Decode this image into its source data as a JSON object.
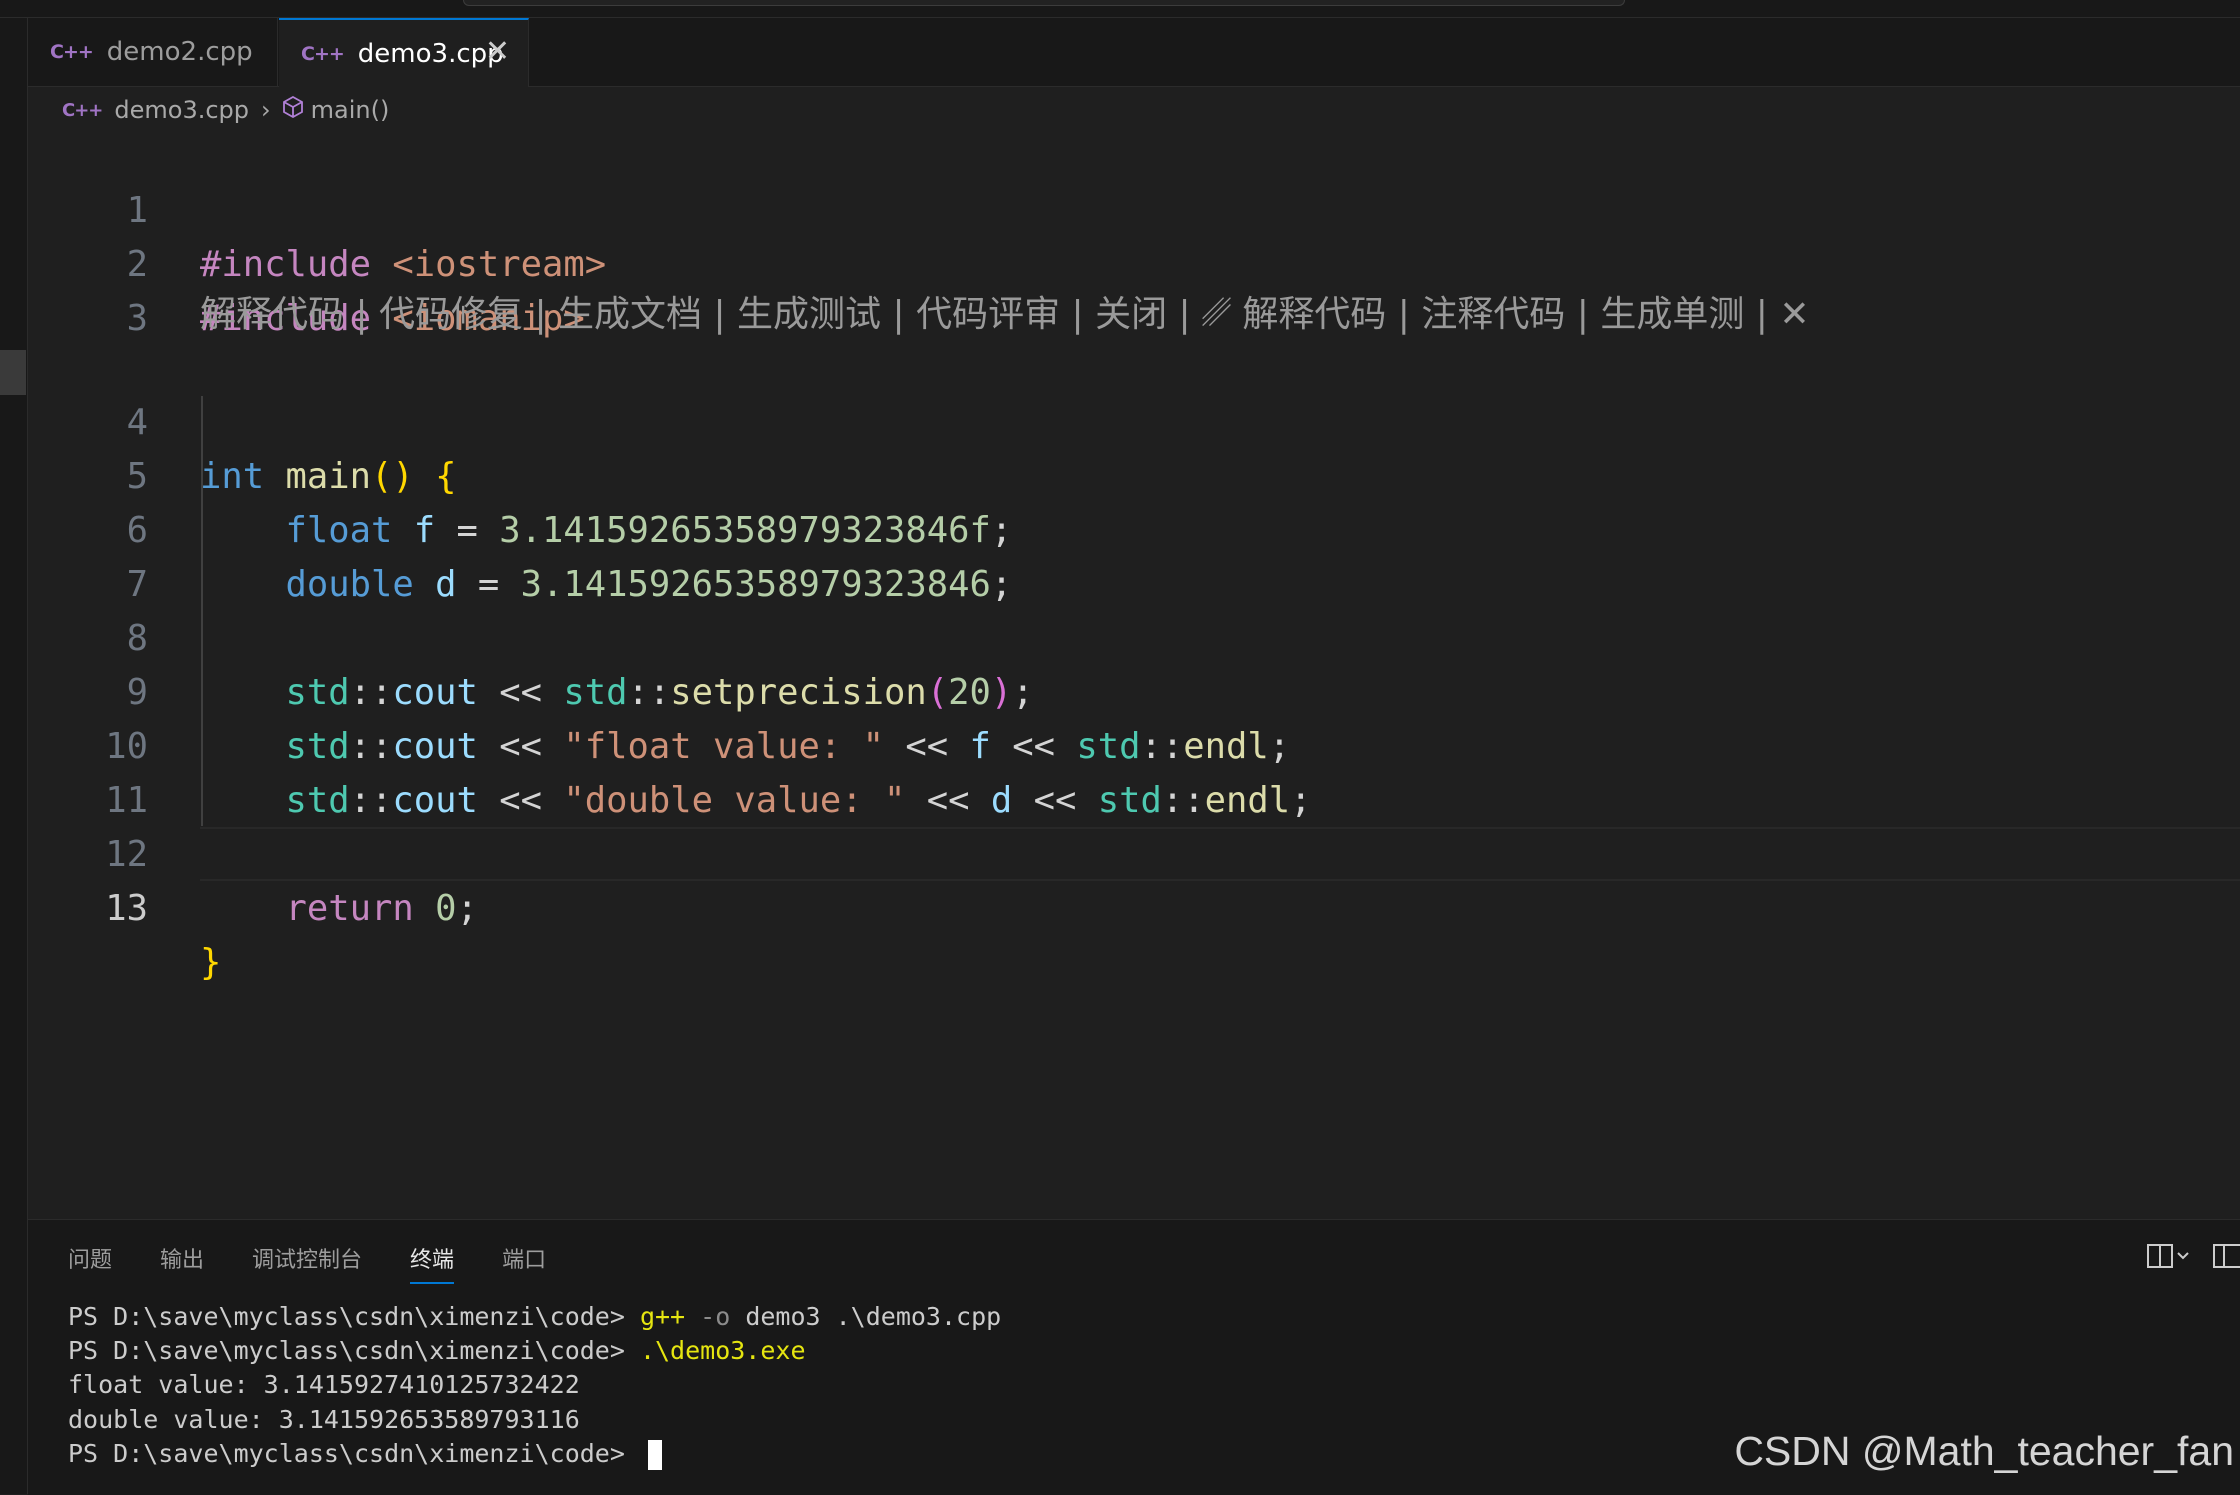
{
  "tabs": [
    {
      "icon": "C++",
      "label": "demo2.cpp",
      "active": false
    },
    {
      "icon": "C++",
      "label": "demo3.cpp",
      "active": true,
      "close": "✕"
    }
  ],
  "breadcrumb": {
    "file": "demo3.cpp",
    "separator": "›",
    "symbol": "main()"
  },
  "codelens": "解释代码 | 代码修复 | 生成文档 | 生成测试 | 代码评审 | 关闭 | ␥ 解释代码 | 注释代码 | 生成单测 | ✕",
  "line_numbers": [
    "1",
    "2",
    "3",
    "4",
    "5",
    "6",
    "7",
    "8",
    "9",
    "10",
    "11",
    "12",
    "13"
  ],
  "code": {
    "l1": {
      "kw": "#include",
      "arg": " <iostream>"
    },
    "l2": {
      "kw": "#include",
      "arg": " <iomanip>"
    },
    "l4": {
      "type": "int",
      "fn": "main",
      "paren": "()",
      "brace": "{"
    },
    "l5": {
      "type": "float",
      "var": "f",
      "op": " = ",
      "num": "3.14159265358979323846f",
      "end": ";"
    },
    "l6": {
      "type": "double",
      "var": "d",
      "op": " = ",
      "num": "3.14159265358979323846",
      "end": ";"
    },
    "l8": {
      "ns1": "std",
      "sep": "::",
      "var1": "cout",
      "op": " << ",
      "ns2": "std",
      "fn": "setprecision",
      "p1": "(",
      "num": "20",
      "p2": ")",
      "end": ";"
    },
    "l9": {
      "ns1": "std",
      "sep": "::",
      "var1": "cout",
      "op": " << ",
      "str": "\"float value: \"",
      "op2": " << ",
      "v": "f",
      "op3": " << ",
      "ns2": "std",
      "fn": "endl",
      "end": ";"
    },
    "l10": {
      "ns1": "std",
      "sep": "::",
      "var1": "cout",
      "op": " << ",
      "str": "\"double value: \"",
      "op2": " << ",
      "v": "d",
      "op3": " << ",
      "ns2": "std",
      "fn": "endl",
      "end": ";"
    },
    "l12": {
      "kw": "return",
      "num": "0",
      "end": ";"
    },
    "l13": {
      "brace": "}"
    }
  },
  "panel": {
    "tabs": [
      "问题",
      "输出",
      "调试控制台",
      "终端",
      "端口"
    ],
    "active_tab": "终端"
  },
  "terminal": {
    "l1_prompt": "PS D:\\save\\myclass\\csdn\\ximenzi\\code> ",
    "l1_cmd": "g++",
    "l1_flag": " -o",
    "l1_args": " demo3 .\\demo3.cpp",
    "l2_prompt": "PS D:\\save\\myclass\\csdn\\ximenzi\\code> ",
    "l2_cmd": ".\\demo3.exe",
    "l3": "float value: 3.1415927410125732422",
    "l4": "double value: 3.141592653589793116",
    "l5_prompt": "PS D:\\save\\myclass\\csdn\\ximenzi\\code> "
  },
  "watermark": "CSDN @Math_teacher_fan",
  "colors": {
    "accent": "#0078d4",
    "keyword": "#c586c0",
    "type": "#569cd6",
    "function": "#dcdcaa",
    "string": "#ce9178",
    "number": "#b5cea8",
    "namespace": "#4ec9b0",
    "variable": "#9cdcfe"
  }
}
